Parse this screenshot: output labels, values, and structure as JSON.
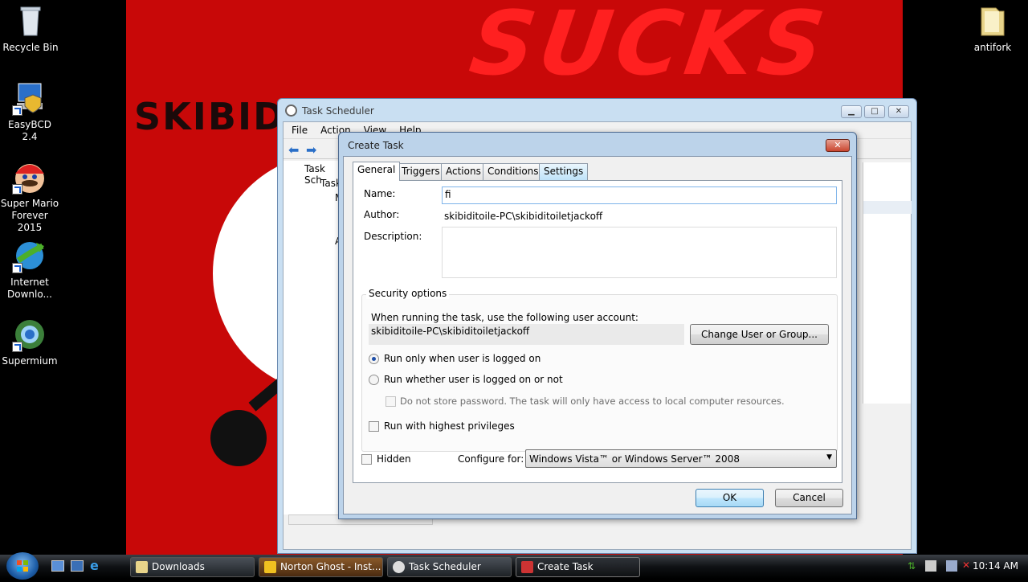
{
  "desktop": {
    "icons": [
      {
        "label": "Recycle Bin"
      },
      {
        "label": "EasyBCD 2.4"
      },
      {
        "label": "Super Mario Forever 2015"
      },
      {
        "label": "Internet Downlo..."
      },
      {
        "label": "Supermium"
      },
      {
        "label": "antifork"
      }
    ],
    "wallpaper_text_left": "SKIBIDI",
    "wallpaper_text_top": "SUCKS"
  },
  "task_scheduler": {
    "title": "Task Scheduler",
    "menu": [
      "File",
      "Action",
      "View",
      "Help"
    ],
    "tree": [
      "Task Sch",
      "Task",
      "M",
      "A"
    ]
  },
  "create_task": {
    "title": "Create Task",
    "close_label": "✕",
    "tabs": [
      "General",
      "Triggers",
      "Actions",
      "Conditions",
      "Settings"
    ],
    "name_label": "Name:",
    "name_value": "fi",
    "author_label": "Author:",
    "author_value": "skibiditoile-PC\\skibiditoiletjackoff",
    "description_label": "Description:",
    "security": {
      "legend": "Security options",
      "account_prompt": "When running the task, use the following user account:",
      "account_value": "skibiditoile-PC\\skibiditoiletjackoff",
      "change_button": "Change User or Group...",
      "radio_logged_on": "Run only when user is logged on",
      "radio_whether": "Run whether user is logged on or not",
      "no_store_password": "Do not store password.  The task will only have access to local computer resources.",
      "highest_privileges": "Run with highest privileges"
    },
    "hidden_label": "Hidden",
    "configure_label": "Configure for:",
    "configure_value": "Windows Vista™ or Windows Server™ 2008",
    "ok": "OK",
    "cancel": "Cancel"
  },
  "taskbar": {
    "buttons": [
      "Downloads",
      "Norton Ghost - Inst...",
      "Task Scheduler",
      "Create Task"
    ],
    "clock": "10:14 AM"
  }
}
